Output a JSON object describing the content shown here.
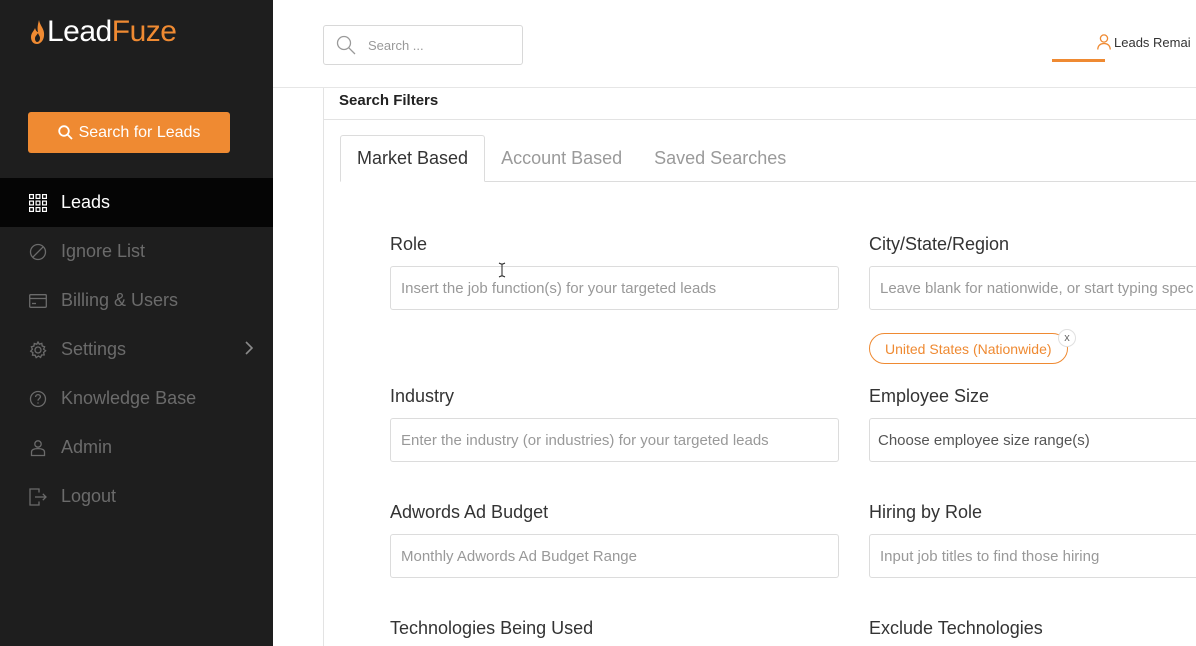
{
  "brand": {
    "lead": "Lead",
    "fuze": "Fuze",
    "accent": "#ef8a32"
  },
  "sidebar": {
    "search_button": {
      "label": "Search for Leads",
      "icon": "search-icon"
    },
    "items": [
      {
        "label": "Leads",
        "icon": "grid-icon",
        "active": true
      },
      {
        "label": "Ignore List",
        "icon": "ignore-icon"
      },
      {
        "label": "Billing & Users",
        "icon": "credit-card-icon"
      },
      {
        "label": "Settings",
        "icon": "gear-icon",
        "has_submenu": true
      },
      {
        "label": "Knowledge Base",
        "icon": "question-icon"
      },
      {
        "label": "Admin",
        "icon": "admin-icon"
      },
      {
        "label": "Logout",
        "icon": "logout-icon"
      }
    ]
  },
  "header": {
    "search": {
      "placeholder": "Search ...",
      "value": ""
    },
    "leads_remaining": "Leads Remai"
  },
  "panel": {
    "title": "Search Filters",
    "tabs": [
      {
        "label": "Market Based",
        "active": true
      },
      {
        "label": "Account Based"
      },
      {
        "label": "Saved Searches"
      }
    ],
    "fields": {
      "role": {
        "label": "Role",
        "placeholder": "Insert the job function(s) for your targeted leads"
      },
      "city": {
        "label": "City/State/Region",
        "placeholder": "Leave blank for nationwide, or start typing spec",
        "tag": "United States (Nationwide)",
        "tag_remove": "x"
      },
      "industry": {
        "label": "Industry",
        "placeholder": "Enter the industry (or industries) for your targeted leads"
      },
      "employee_size": {
        "label": "Employee Size",
        "placeholder": "Choose employee size range(s)"
      },
      "adwords": {
        "label": "Adwords Ad Budget",
        "placeholder": "Monthly Adwords Ad Budget Range"
      },
      "hiring": {
        "label": "Hiring by Role",
        "placeholder": "Input job titles to find those hiring"
      },
      "technologies": {
        "label": "Technologies Being Used"
      },
      "exclude_technologies": {
        "label": "Exclude Technologies"
      }
    }
  }
}
